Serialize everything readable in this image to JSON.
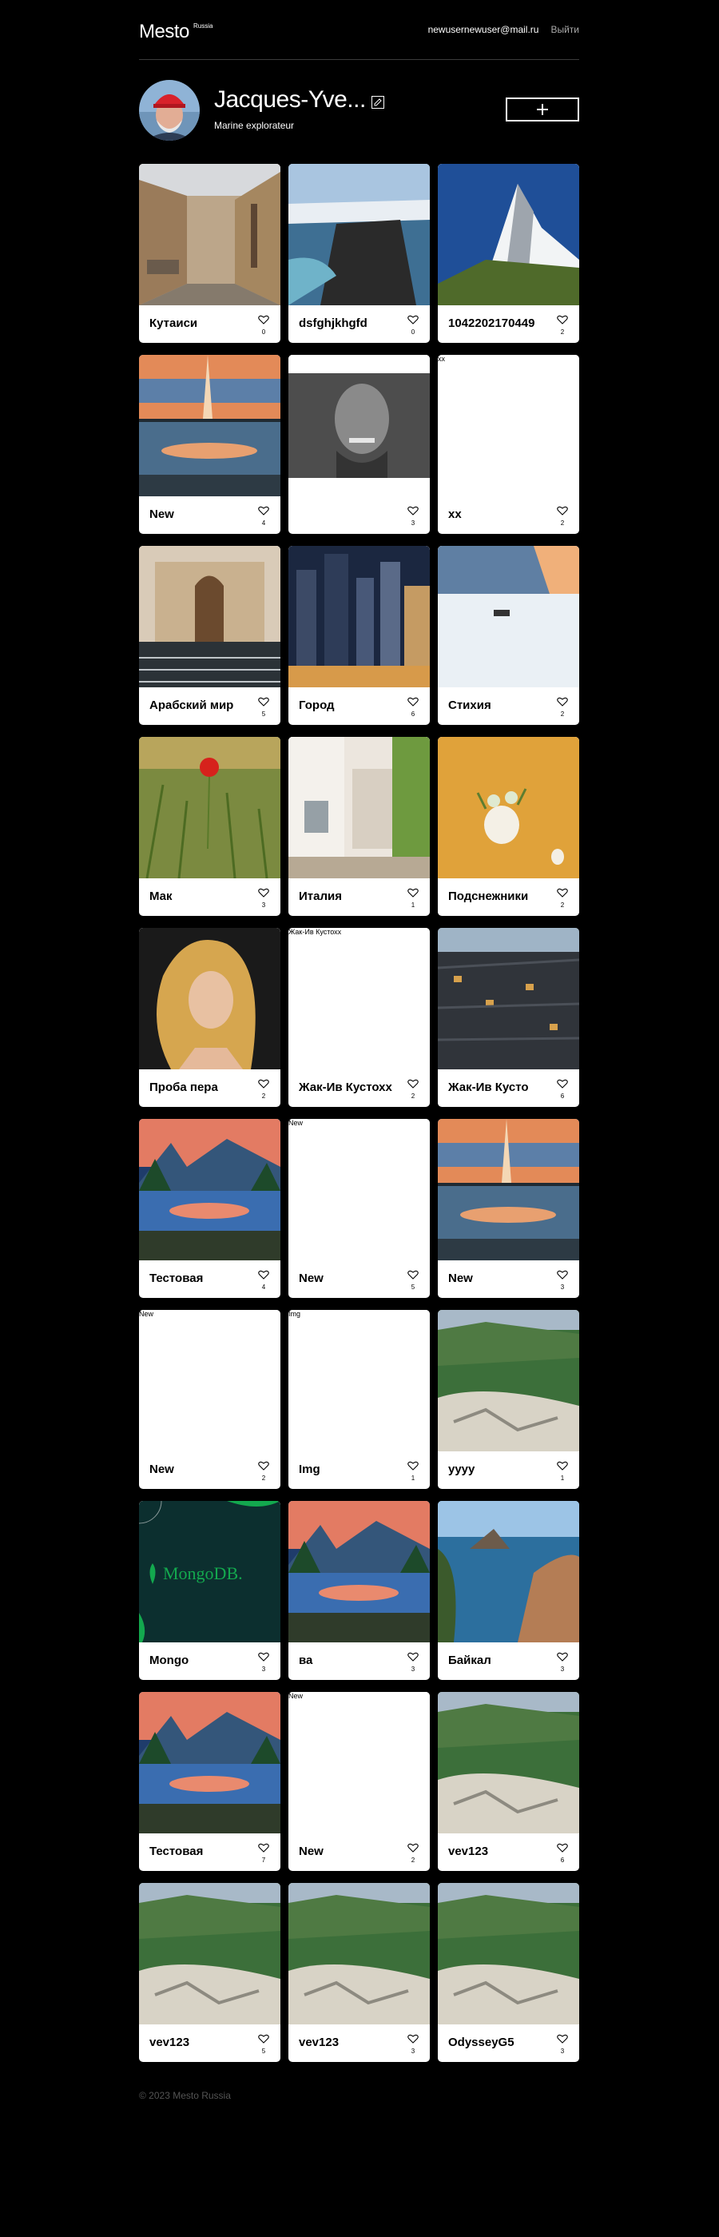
{
  "header": {
    "logo": "Mesto",
    "logo_sup": "Russia",
    "email": "newusernewuser@mail.ru",
    "logout": "Выйти"
  },
  "profile": {
    "name": "Jacques-Yve...",
    "about": "Marine explorateur"
  },
  "cards": [
    {
      "title": "Кутаиси",
      "likes": "0",
      "img": "street",
      "caption": ""
    },
    {
      "title": "dsfghjkhgfd",
      "likes": "0",
      "img": "cliff",
      "caption": ""
    },
    {
      "title": "1042202170449",
      "likes": "2",
      "img": "mountain",
      "caption": ""
    },
    {
      "title": "New",
      "likes": "4",
      "img": "lake",
      "caption": ""
    },
    {
      "title": "",
      "likes": "3",
      "img": "face",
      "caption": ""
    },
    {
      "title": "xx",
      "likes": "2",
      "img": "blank",
      "caption": "xx"
    },
    {
      "title": "Арабский мир",
      "likes": "5",
      "img": "arab",
      "caption": ""
    },
    {
      "title": "Город",
      "likes": "6",
      "img": "city",
      "caption": ""
    },
    {
      "title": "Стихия",
      "likes": "2",
      "img": "snow",
      "caption": ""
    },
    {
      "title": "Мак",
      "likes": "3",
      "img": "poppy",
      "caption": ""
    },
    {
      "title": "Италия",
      "likes": "1",
      "img": "italy",
      "caption": ""
    },
    {
      "title": "Подснежники",
      "likes": "2",
      "img": "flowers",
      "caption": ""
    },
    {
      "title": "Проба пера",
      "likes": "2",
      "img": "woman",
      "caption": ""
    },
    {
      "title": "Жак-Ив Кустохх",
      "likes": "2",
      "img": "blank",
      "caption": "Жак-Ив Кустохх"
    },
    {
      "title": "Жак-Ив Кусто",
      "likes": "6",
      "img": "building",
      "caption": ""
    },
    {
      "title": "Тестовая",
      "likes": "4",
      "img": "yosemite",
      "caption": ""
    },
    {
      "title": "New",
      "likes": "5",
      "img": "blank",
      "caption": "New"
    },
    {
      "title": "New",
      "likes": "3",
      "img": "lake",
      "caption": ""
    },
    {
      "title": "New",
      "likes": "2",
      "img": "blank",
      "caption": "New"
    },
    {
      "title": "Img",
      "likes": "1",
      "img": "blank",
      "caption": "Img"
    },
    {
      "title": "уууу",
      "likes": "1",
      "img": "valley",
      "caption": ""
    },
    {
      "title": "Mongo",
      "likes": "3",
      "img": "mongo",
      "caption": ""
    },
    {
      "title": "ва",
      "likes": "3",
      "img": "yosemite",
      "caption": ""
    },
    {
      "title": "Байкал",
      "likes": "3",
      "img": "baikal",
      "caption": ""
    },
    {
      "title": "Тестовая",
      "likes": "7",
      "img": "yosemite",
      "caption": ""
    },
    {
      "title": "New",
      "likes": "2",
      "img": "blank",
      "caption": "New"
    },
    {
      "title": "vev123",
      "likes": "6",
      "img": "valley",
      "caption": ""
    },
    {
      "title": "vev123",
      "likes": "5",
      "img": "valley",
      "caption": ""
    },
    {
      "title": "vev123",
      "likes": "3",
      "img": "valley",
      "caption": ""
    },
    {
      "title": "OdysseyG5",
      "likes": "3",
      "img": "valley",
      "caption": ""
    }
  ],
  "mongo_text": "MongoDB.",
  "footer": "© 2023 Mesto Russia"
}
